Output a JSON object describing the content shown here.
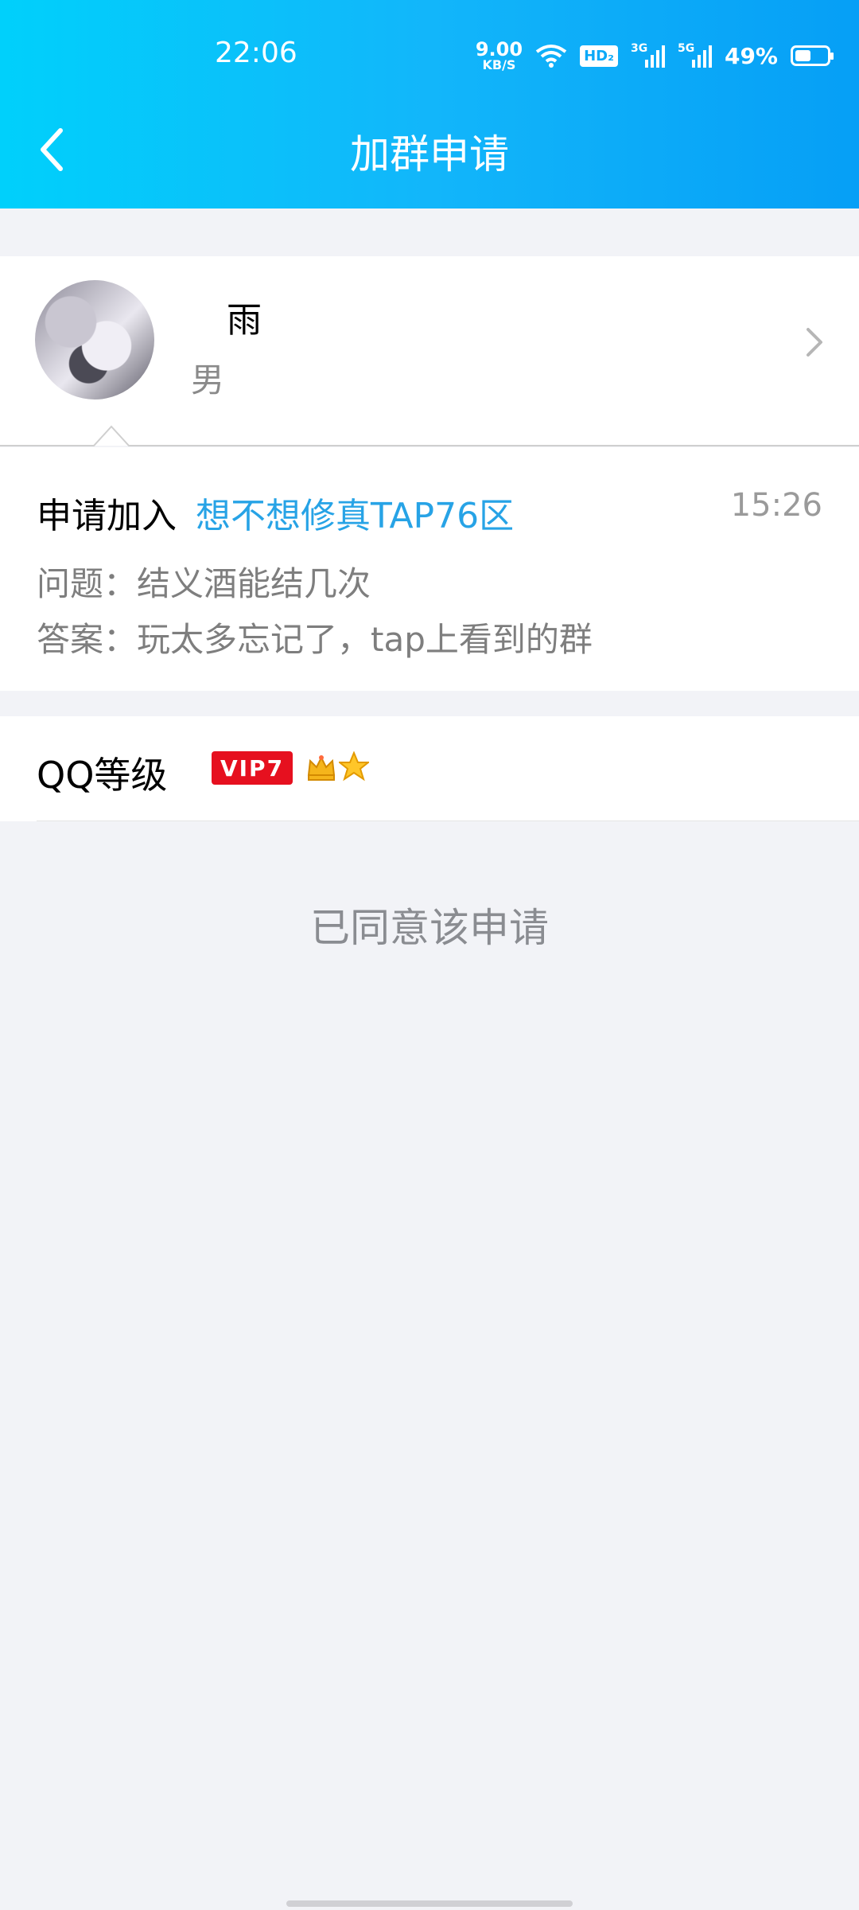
{
  "status_bar": {
    "time": "22:06",
    "net_speed_value": "9.00",
    "net_speed_unit": "KB/S",
    "hd_label": "HD₂",
    "signal1_label": "3G",
    "signal2_label": "5G",
    "battery_percent": "49%",
    "battery_level": 0.49
  },
  "header": {
    "back_icon": "chevron-left-icon",
    "title": "加群申请"
  },
  "applicant": {
    "name": "雨",
    "gender": "男"
  },
  "request": {
    "label": "申请加入",
    "group_name": "想不想修真TAP76区",
    "time": "15:26",
    "question": "问题：结义酒能结几次",
    "answer": "答案：玩太多忘记了，tap上看到的群"
  },
  "level": {
    "label": "QQ等级",
    "vip_badge": "VIP7",
    "icons": [
      "crown-icon",
      "star-icon"
    ]
  },
  "status_message": "已同意该申请",
  "colors": {
    "header_gradient": [
      "#00d0fb",
      "#069ff6"
    ],
    "link": "#27a3e6",
    "vip": "#e6101f",
    "background": "#f2f3f7"
  }
}
